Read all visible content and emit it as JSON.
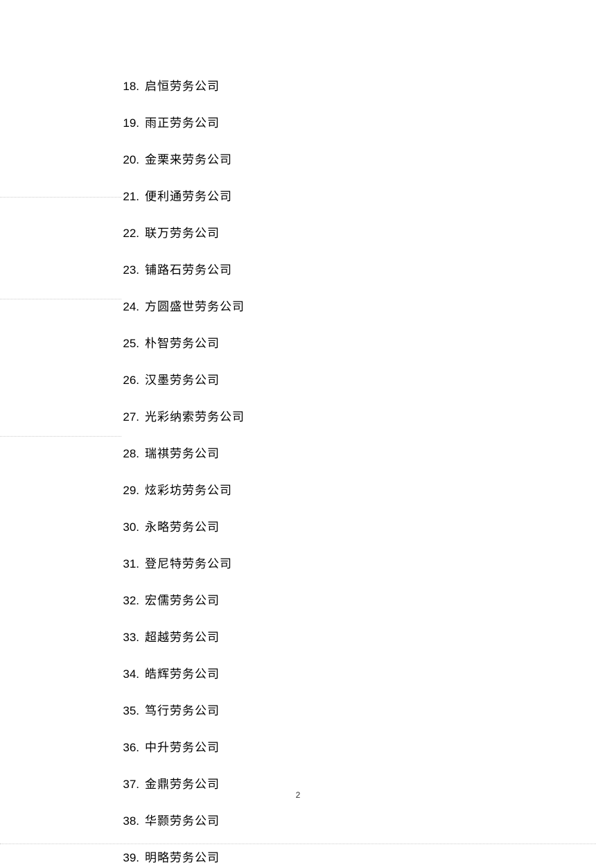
{
  "list": {
    "startNumber": 18,
    "items": [
      "启恒劳务公司",
      "雨正劳务公司",
      "金栗来劳务公司",
      "便利通劳务公司",
      "联万劳务公司",
      "铺路石劳务公司",
      "方圆盛世劳务公司",
      "朴智劳务公司",
      "汉墨劳务公司",
      "光彩纳索劳务公司",
      "瑞祺劳务公司",
      "炫彩坊劳务公司",
      "永略劳务公司",
      "登尼特劳务公司",
      "宏儒劳务公司",
      "超越劳务公司",
      "皓辉劳务公司",
      "笃行劳务公司",
      "中升劳务公司",
      "金鼎劳务公司",
      "华颢劳务公司",
      "明略劳务公司"
    ]
  },
  "pageNumber": "2"
}
